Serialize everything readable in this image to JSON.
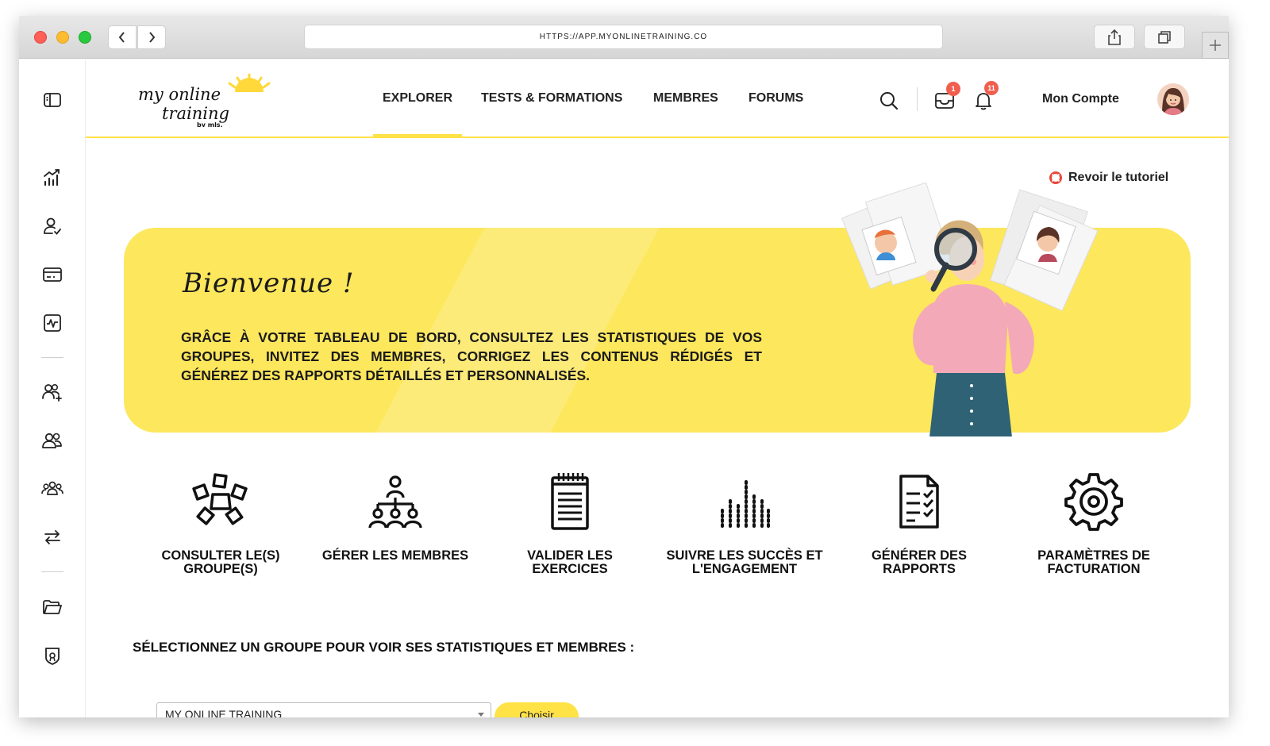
{
  "browser": {
    "url": "HTTPS://APP.MYONLINETRAINING.CO"
  },
  "sidebar": {
    "items": [
      {
        "icon": "panel-toggle-icon"
      },
      {
        "icon": "analytics-chart-icon"
      },
      {
        "icon": "user-check-icon"
      },
      {
        "icon": "credit-card-icon"
      },
      {
        "icon": "activity-monitor-icon"
      },
      {
        "icon": "add-user-icon"
      },
      {
        "icon": "users-icon"
      },
      {
        "icon": "team-icon"
      },
      {
        "icon": "swap-arrows-icon"
      },
      {
        "icon": "folder-icon"
      },
      {
        "icon": "badge-icon"
      }
    ]
  },
  "header": {
    "logo_text": "my online training",
    "logo_sub": "by mls.",
    "nav": [
      "EXPLORER",
      "TESTS & FORMATIONS",
      "MEMBRES",
      "FORUMS"
    ],
    "active_nav": "EXPLORER",
    "inbox_badge": "1",
    "notif_badge": "11",
    "account_label": "Mon Compte"
  },
  "tutorial_link": "Revoir le tutoriel",
  "banner": {
    "welcome": "Bienvenue !",
    "intro": "Grâce à votre tableau de bord, consultez les statistiques de vos groupes, invitez des membres, corrigez les contenus rédigés et générez des rapports détaillés et personnalisés."
  },
  "actions": [
    {
      "label": "CONSULTER LE(S) GROUPE(S)",
      "icon": "groups-network-icon"
    },
    {
      "label": "GÉRER LES MEMBRES",
      "icon": "org-chart-icon"
    },
    {
      "label": "VALIDER LES EXERCICES",
      "icon": "notepad-icon"
    },
    {
      "label": "SUIVRE LES SUCCÈS ET L'ENGAGEMENT",
      "icon": "equalizer-bars-icon"
    },
    {
      "label": "GÉNÉRER DES RAPPORTS",
      "icon": "checklist-report-icon"
    },
    {
      "label": "PARAMÈTRES DE FACTURATION",
      "icon": "settings-gear-icon"
    }
  ],
  "group_section": {
    "title": "SÉLECTIONNEZ UN GROUPE POUR VOIR SES STATISTIQUES ET MEMBRES :",
    "selected": "MY ONLINE TRAINING",
    "button": "Choisir"
  },
  "colors": {
    "accent": "#ffe246",
    "banner": "#fde75c",
    "badge": "#f15e4d"
  }
}
